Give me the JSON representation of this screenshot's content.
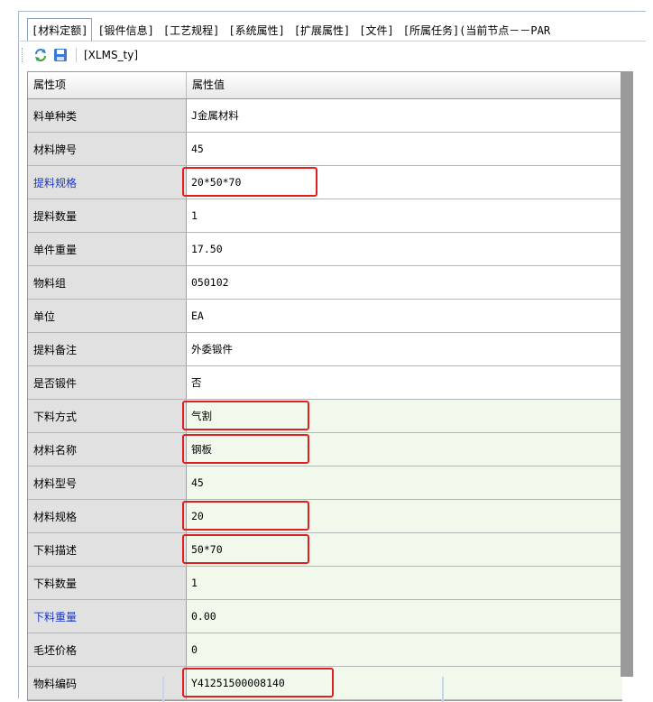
{
  "tabs": [
    "[材料定额]",
    "[锻件信息]",
    "[工艺规程]",
    "[系统属性]",
    "[扩展属性]",
    "[文件]",
    "[所属任务](当前节点－－PAR"
  ],
  "toolbar": {
    "refresh_icon": "refresh-icon",
    "save_icon": "save-icon",
    "label": "[XLMS_ty]"
  },
  "grid": {
    "header": {
      "name": "属性项",
      "value": "属性值"
    },
    "rows": [
      {
        "name": "料单种类",
        "value": "J金属材料"
      },
      {
        "name": "材料牌号",
        "value": "45"
      },
      {
        "name": "提料规格",
        "value": "20*50*70"
      },
      {
        "name": "提料数量",
        "value": "1"
      },
      {
        "name": "单件重量",
        "value": "17.50"
      },
      {
        "name": "物料组",
        "value": "050102"
      },
      {
        "name": "单位",
        "value": "EA"
      },
      {
        "name": "提料备注",
        "value": "外委锻件"
      },
      {
        "name": "是否锻件",
        "value": "否"
      },
      {
        "name": "下料方式",
        "value": "气割"
      },
      {
        "name": "材料名称",
        "value": "钢板"
      },
      {
        "name": "材料型号",
        "value": "45"
      },
      {
        "name": "材料规格",
        "value": "20"
      },
      {
        "name": "下料描述",
        "value": "50*70"
      },
      {
        "name": "下料数量",
        "value": "1"
      },
      {
        "name": "下料重量",
        "value": "0.00"
      },
      {
        "name": "毛坯价格",
        "value": "0"
      },
      {
        "name": "物料编码",
        "value": "Y41251500008140"
      }
    ]
  },
  "colors": {
    "highlight": "#e02020",
    "blue_label": "#1b36c8",
    "green_row": "#f1f8ec"
  }
}
